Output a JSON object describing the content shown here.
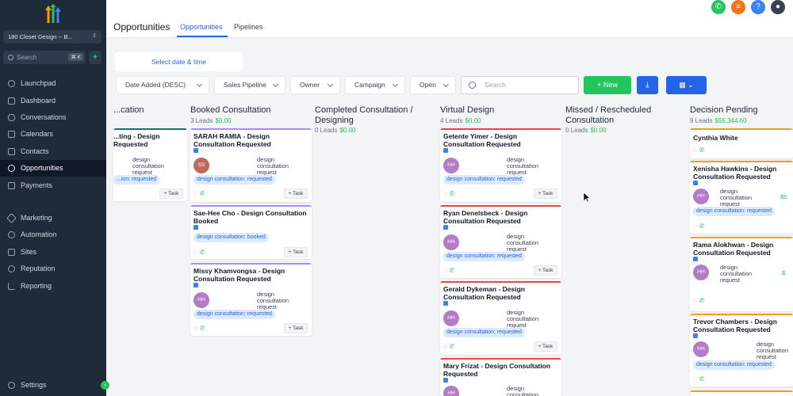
{
  "sidebar": {
    "location": "180 Closet Design -- B...",
    "search_placeholder": "Search",
    "search_shortcut": "⌘ K",
    "items": [
      {
        "label": "Launchpad"
      },
      {
        "label": "Dashboard"
      },
      {
        "label": "Conversations"
      },
      {
        "label": "Calendars"
      },
      {
        "label": "Contacts"
      },
      {
        "label": "Opportunities"
      },
      {
        "label": "Payments"
      },
      {
        "label": "Marketing"
      },
      {
        "label": "Automation"
      },
      {
        "label": "Sites"
      },
      {
        "label": "Reputation"
      },
      {
        "label": "Reporting"
      },
      {
        "label": "Settings"
      }
    ]
  },
  "header": {
    "title": "Opportunities",
    "tabs": [
      "Opportunities",
      "Pipelines"
    ]
  },
  "filters": {
    "date_button": "Select date & time",
    "sort": "Date Added (DESC)",
    "pipeline": "Sales Pipeline",
    "owner": "Owner",
    "campaign": "Campaign",
    "status": "Open",
    "search_placeholder": "Search",
    "new_label": "New"
  },
  "columns": [
    {
      "name": "...cation",
      "count": "",
      "amount": ""
    },
    {
      "name": "Booked Consultation",
      "count": "3 Leads",
      "amount": "$0.00"
    },
    {
      "name": "Completed Consultation / Designing",
      "count": "0 Leads",
      "amount": "$0.00"
    },
    {
      "name": "Virtual Design",
      "count": "4 Leads",
      "amount": "$0.00"
    },
    {
      "name": "Missed / Rescheduled Consultation",
      "count": "0 Leads",
      "amount": "$0.00"
    },
    {
      "name": "Decision Pending",
      "count": "9 Leads",
      "amount": "$55,344.60"
    }
  ],
  "cards": {
    "c0": {
      "title": "...ting - Design Requested",
      "src": "design consultation request",
      "tag": "...ion: requested",
      "task": "+ Task"
    },
    "b1": {
      "title": "SARAH RAMIA - Design Consultation Requested",
      "initials": "SS",
      "src": "design consultation request",
      "tag": "design consultation: requested",
      "task": "+ Task"
    },
    "b2": {
      "title": "Sae-Hee Cho - Design Consultation Booked",
      "tag": "design consultation: booked",
      "task": "+ Task"
    },
    "b3": {
      "title": "Missy Khamvongsa - Design Consultation Requested",
      "initials": "HH",
      "src": "design consultation request",
      "tag": "design consultation: requested",
      "task": "+ Task"
    },
    "v1": {
      "title": "Getente Yimer - Design Consultation Requested",
      "initials": "HH",
      "src": "design consultation request",
      "tag": "design consultation: requested",
      "task": "+ Task"
    },
    "v2": {
      "title": "Ryan Denelsbeck - Design Consultation Requested",
      "initials": "HH",
      "src": "design consultation request",
      "tag": "design consultation: requested",
      "task": "+ Task"
    },
    "v3": {
      "title": "Gerald Dykeman - Design Consultation Requested",
      "initials": "HH",
      "src": "design consultation request",
      "tag": "design consultation: requested",
      "task": "+ Task"
    },
    "v4": {
      "title": "Mary Frizat - Design Consultation Requested",
      "initials": "HH",
      "src": "design consultation"
    },
    "d1": {
      "title": "Cynthia White"
    },
    "d2": {
      "title": "Xenisha Hawkins - Design Consultation Requested",
      "initials": "HH",
      "src": "design consultation request",
      "tag": "design consultation: requested",
      "amt": "$5"
    },
    "d3": {
      "title": "Rama Alokhwan - Design Consultation Requested",
      "initials": "HH",
      "src": "design consultation request",
      "amt": "$"
    },
    "d4": {
      "title": "Trevor Chambers - Design Consultation Requested",
      "initials": "HH",
      "src": "design consultation request",
      "tag": "design consultation: requested"
    }
  },
  "colors": {
    "green": "#22c55e",
    "blue": "#2563eb",
    "sidebar_bg": "#202b3a",
    "bar_booked": "#a78bfa",
    "bar_virtual": "#ef4444",
    "bar_decision": "#f59e0b",
    "bar_first": "#0f766e",
    "avatar_purple": "#b37cc7",
    "avatar_rust": "#c2665a"
  }
}
